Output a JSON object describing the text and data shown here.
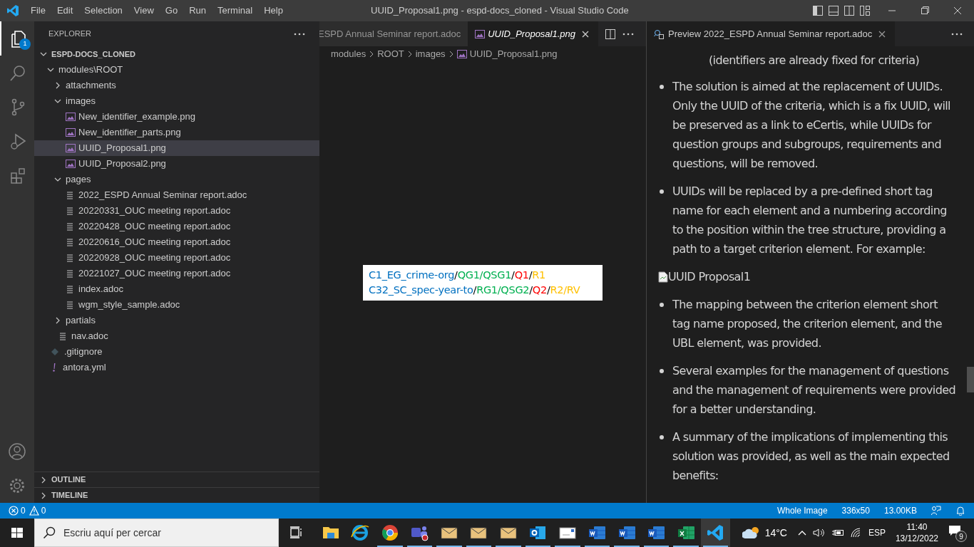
{
  "title_bar": {
    "menu": [
      "File",
      "Edit",
      "Selection",
      "View",
      "Go",
      "Run",
      "Terminal",
      "Help"
    ],
    "title": "UUID_Proposal1.png - espd-docs_cloned - Visual Studio Code"
  },
  "activity_bar": {
    "items": [
      {
        "kind": "explorer",
        "selected": true,
        "badge": "1"
      },
      {
        "kind": "search",
        "selected": false
      },
      {
        "kind": "source_control",
        "selected": false
      },
      {
        "kind": "run",
        "selected": false
      },
      {
        "kind": "extensions",
        "selected": false
      }
    ],
    "bottom": [
      {
        "kind": "account"
      },
      {
        "kind": "settings"
      }
    ]
  },
  "sidebar": {
    "title": "EXPLORER",
    "tree": [
      {
        "label": "ESPD-DOCS_CLONED",
        "kind": "root",
        "expanded": true,
        "selected": false,
        "children": [
          {
            "label": "modules\\ROOT",
            "kind": "folder",
            "expanded": true,
            "selected": false,
            "children": [
              {
                "label": "attachments",
                "kind": "folder",
                "expanded": false,
                "selected": false
              },
              {
                "label": "images",
                "kind": "folder",
                "expanded": true,
                "selected": false,
                "children": [
                  {
                    "label": "New_identifier_example.png",
                    "kind": "image",
                    "selected": false
                  },
                  {
                    "label": "New_identifier_parts.png",
                    "kind": "image",
                    "selected": false
                  },
                  {
                    "label": "UUID_Proposal1.png",
                    "kind": "image",
                    "selected": true
                  },
                  {
                    "label": "UUID_Proposal2.png",
                    "kind": "image",
                    "selected": false
                  }
                ]
              },
              {
                "label": "pages",
                "kind": "folder",
                "expanded": true,
                "selected": false,
                "children": [
                  {
                    "label": "2022_ESPD Annual Seminar report.adoc",
                    "kind": "doc",
                    "selected": false
                  },
                  {
                    "label": "20220331_OUC meeting report.adoc",
                    "kind": "doc",
                    "selected": false
                  },
                  {
                    "label": "20220428_OUC meeting report.adoc",
                    "kind": "doc",
                    "selected": false
                  },
                  {
                    "label": "20220616_OUC meeting report.adoc",
                    "kind": "doc",
                    "selected": false
                  },
                  {
                    "label": "20220928_OUC meeting report.adoc",
                    "kind": "doc",
                    "selected": false
                  },
                  {
                    "label": "20221027_OUC meeting report.adoc",
                    "kind": "doc",
                    "selected": false
                  },
                  {
                    "label": "index.adoc",
                    "kind": "doc",
                    "selected": false
                  },
                  {
                    "label": "wgm_style_sample.adoc",
                    "kind": "doc",
                    "selected": false
                  }
                ]
              },
              {
                "label": "partials",
                "kind": "folder",
                "expanded": false,
                "selected": false
              },
              {
                "label": "nav.adoc",
                "kind": "doc",
                "selected": false
              }
            ]
          },
          {
            "label": ".gitignore",
            "kind": "ignore",
            "selected": false
          },
          {
            "label": "antora.yml",
            "kind": "yaml",
            "selected": false
          }
        ]
      }
    ],
    "sections": [
      {
        "label": "OUTLINE",
        "expanded": false
      },
      {
        "label": "TIMELINE",
        "expanded": false
      }
    ]
  },
  "editor": {
    "tabs": [
      {
        "label": "ESPD Annual Seminar report.adoc",
        "kind": "doc",
        "selected": false
      },
      {
        "label": "UUID_Proposal1.png",
        "kind": "image",
        "selected": true
      }
    ],
    "breadcrumbs": [
      "modules",
      "ROOT",
      "images",
      "UUID_Proposal1.png"
    ],
    "image_lines": [
      [
        {
          "text": "C1_EG_crime-org",
          "color": "#0070c0"
        },
        {
          "text": "/",
          "kind": "separator"
        },
        {
          "text": "QG1/QSG1",
          "color": "#00b050"
        },
        {
          "text": "/",
          "kind": "separator"
        },
        {
          "text": "Q1",
          "color": "#ff0000"
        },
        {
          "text": "/",
          "kind": "separator"
        },
        {
          "text": "R1",
          "color": "#ffc000"
        }
      ],
      [
        {
          "text": "C32_SC_spec-year-to",
          "color": "#0070c0"
        },
        {
          "text": "/",
          "kind": "separator"
        },
        {
          "text": "RG1/QSG2",
          "color": "#00b050"
        },
        {
          "text": "/",
          "kind": "separator"
        },
        {
          "text": "Q2",
          "color": "#ff0000"
        },
        {
          "text": "/",
          "kind": "separator"
        },
        {
          "text": "R2/RV",
          "color": "#ffc000"
        }
      ]
    ]
  },
  "preview": {
    "tab": {
      "label": "Preview 2022_ESPD Annual Seminar report.adoc",
      "selected": true
    },
    "blocks": [
      {
        "kind": "text",
        "text": "(identifiers are already fixed for criteria)"
      },
      {
        "kind": "bullet",
        "text": "The solution is aimed at the replacement of UUIDs. Only the UUID of the criteria, which is a fix UUID, will be preserved as a link to eCertis, while UUIDs for question groups and subgroups, requirements and questions, will be removed."
      },
      {
        "kind": "bullet",
        "text": "UUIDs will be replaced by a pre-defined short tag name for each element and a numbering according to the position within the tree structure, providing a path to a target criterion element. For example:"
      },
      {
        "kind": "image_alt",
        "text": "UUID Proposal1"
      },
      {
        "kind": "bullet",
        "text": "The mapping between the criterion element short tag name proposed, the criterion element, and the UBL element, was provided."
      },
      {
        "kind": "bullet",
        "text": "Several examples for the management of questions and the management of requirements were provided for a better understanding."
      },
      {
        "kind": "bullet",
        "text": "A summary of the implications of implementing this solution was provided, as well as the main expected benefits:"
      }
    ]
  },
  "status_bar": {
    "errors": "0",
    "warnings": "0",
    "items": [
      "Whole Image",
      "336x50",
      "13.00KB"
    ]
  },
  "taskbar": {
    "search_placeholder": "Escriu aquí per cercar",
    "apps": [
      {
        "kind": "files",
        "running": false,
        "selected": false
      },
      {
        "kind": "browser_e",
        "running": false,
        "selected": false
      },
      {
        "kind": "browser_ring",
        "running": true,
        "selected": false
      },
      {
        "kind": "chat",
        "running": true,
        "selected": false
      },
      {
        "kind": "mail",
        "running": true,
        "selected": false
      },
      {
        "kind": "mail",
        "running": true,
        "selected": false
      },
      {
        "kind": "mail",
        "running": true,
        "selected": false
      },
      {
        "kind": "outlook",
        "running": true,
        "selected": false
      },
      {
        "kind": "letter",
        "running": true,
        "selected": false
      },
      {
        "kind": "word",
        "running": true,
        "selected": false
      },
      {
        "kind": "word",
        "running": true,
        "selected": false
      },
      {
        "kind": "word",
        "running": true,
        "selected": false
      },
      {
        "kind": "excel",
        "running": true,
        "selected": false
      },
      {
        "kind": "code",
        "running": true,
        "selected": true
      }
    ],
    "weather": "14°C",
    "language": "ESP",
    "time": "11:40",
    "date": "13/12/2022",
    "notifications": "9"
  }
}
